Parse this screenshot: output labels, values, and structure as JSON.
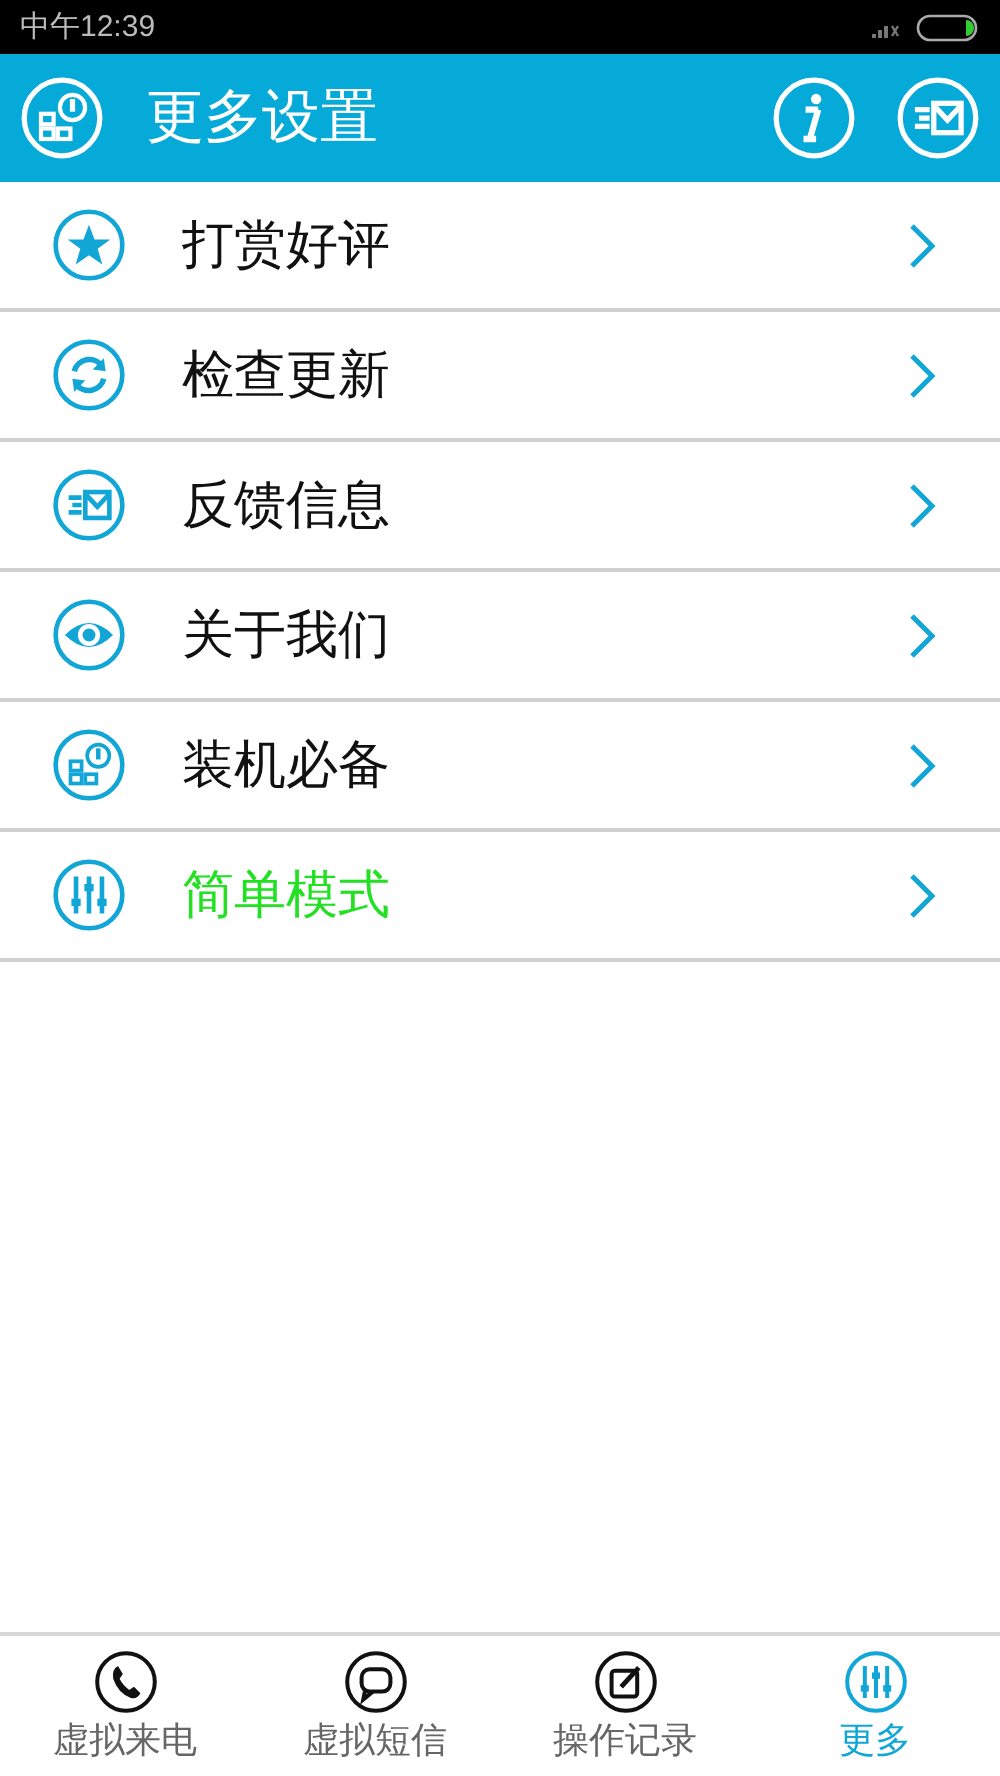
{
  "status_bar": {
    "time": "中午12:39"
  },
  "header": {
    "title": "更多设置"
  },
  "menu": [
    {
      "label": "打赏好评",
      "highlighted": false
    },
    {
      "label": "检查更新",
      "highlighted": false
    },
    {
      "label": "反馈信息",
      "highlighted": false
    },
    {
      "label": "关于我们",
      "highlighted": false
    },
    {
      "label": "装机必备",
      "highlighted": false
    },
    {
      "label": "简单模式",
      "highlighted": true
    }
  ],
  "tabs": [
    {
      "label": "虚拟来电",
      "selected": false
    },
    {
      "label": "虚拟短信",
      "selected": false
    },
    {
      "label": "操作记录",
      "selected": false
    },
    {
      "label": "更多",
      "selected": true
    }
  ]
}
